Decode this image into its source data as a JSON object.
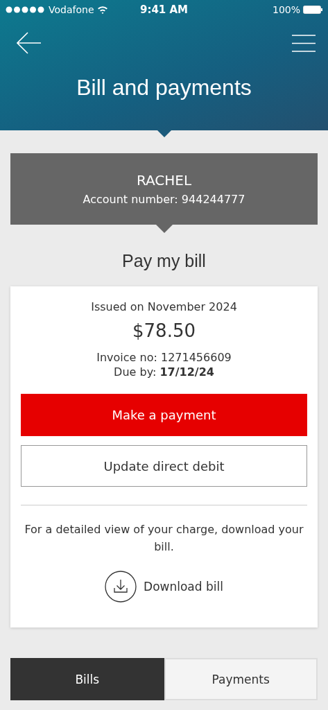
{
  "status_bar": {
    "carrier": "Vodafone",
    "time": "9:41 AM",
    "battery": "100%"
  },
  "header": {
    "title": "Bill and payments"
  },
  "account": {
    "name": "RACHEL",
    "number": "Account number: 944244777"
  },
  "section_title": "Pay my bill",
  "bill": {
    "issued": "Issued on November 2024",
    "amount": "$78.50",
    "invoice": "Invoice no: 1271456609",
    "due": "Due by: **17/12/24**",
    "buttons": [
      {
        "label": "Make a payment",
        "kind": "primary"
      },
      {
        "label": "Update direct debit",
        "kind": "secondary"
      }
    ],
    "note": "For a detailed view of your charge, download your bill.",
    "download": "Download bill"
  },
  "tabs": [
    {
      "label": "Bills",
      "selected": true
    },
    {
      "label": "Payments",
      "selected": false
    }
  ]
}
